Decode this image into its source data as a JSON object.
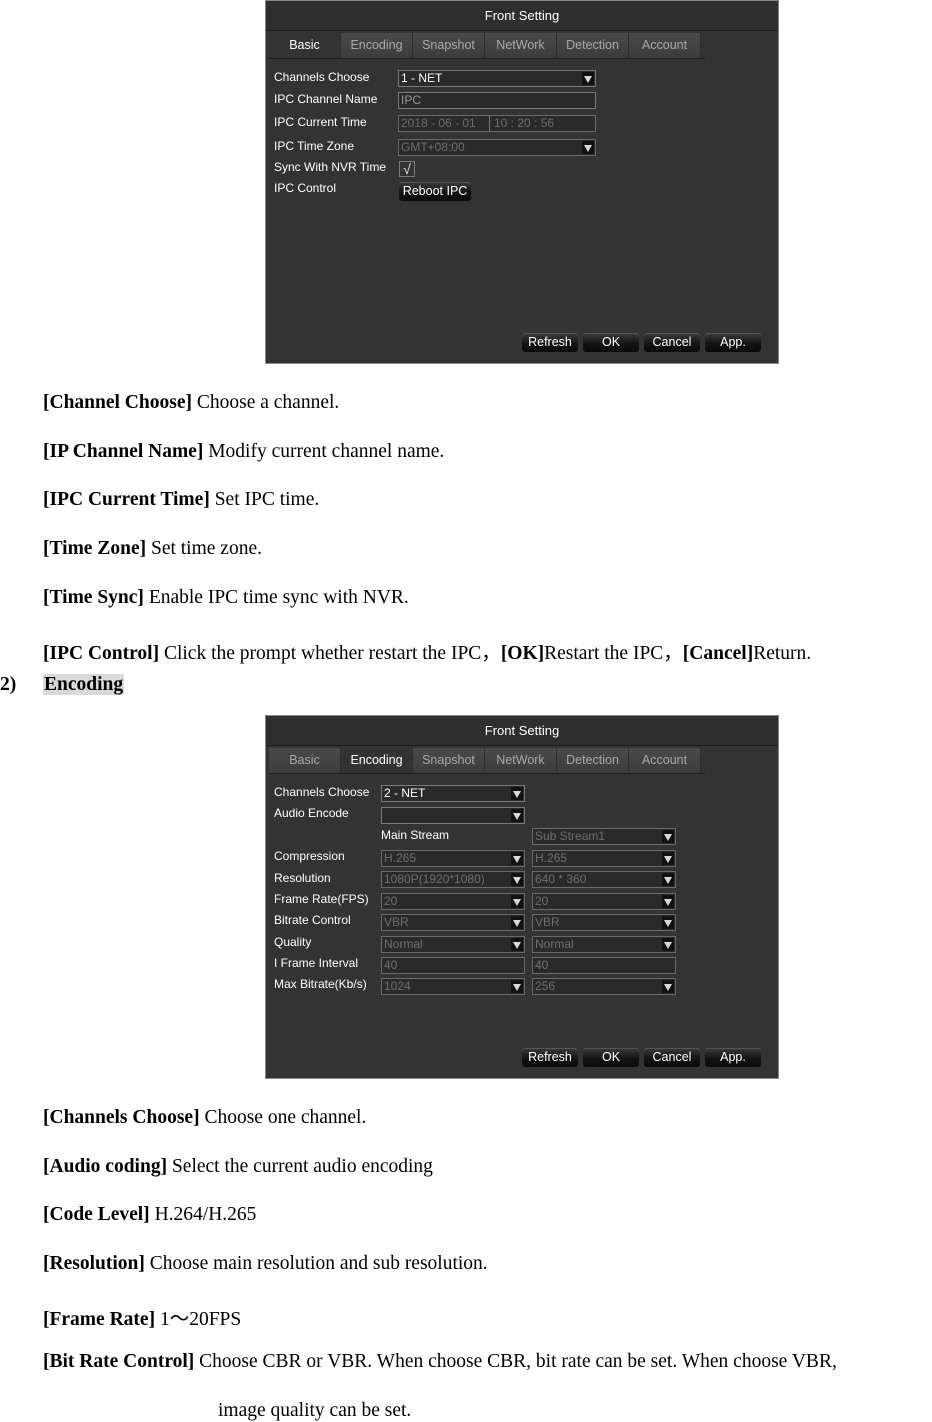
{
  "panel1": {
    "title": "Front Setting",
    "tabs": [
      "Basic",
      "Encoding",
      "Snapshot",
      "NetWork",
      "Detection",
      "Account"
    ],
    "active_tab": "Basic",
    "labels": {
      "channels_choose": "Channels Choose",
      "ipc_channel_name": "IPC Channel Name",
      "ipc_current_time": "IPC Current Time",
      "ipc_time_zone": "IPC Time Zone",
      "sync_with_nvr": "Sync With NVR Time",
      "ipc_control": "IPC Control"
    },
    "values": {
      "channel": "1 - NET",
      "channel_name": "IPC",
      "date": "2018  - 06 - 01",
      "time": "10 : 20 : 56",
      "time_zone": "GMT+08:00",
      "sync_checked": "√"
    },
    "reboot_button": "Reboot IPC",
    "buttons": {
      "refresh": "Refresh",
      "ok": "OK",
      "cancel": "Cancel",
      "apply": "App."
    }
  },
  "desc1": [
    {
      "bold": "[Channel Choose]",
      "text": " Choose a channel."
    },
    {
      "bold": "[IP Channel Name]",
      "text": " Modify current channel name."
    },
    {
      "bold": "[IPC Current Time]",
      "text": " Set IPC time."
    },
    {
      "bold": "[Time Zone]",
      "text": " Set time zone."
    },
    {
      "bold": "[Time Sync]",
      "text": " Enable IPC time sync with NVR."
    }
  ],
  "ipc_control_desc": {
    "b1": "[IPC Control]",
    "t1": " Click the prompt whether restart the IPC，",
    "b2": "[OK]",
    "t2": "Restart the IPC，",
    "b3": "[Cancel]",
    "t3": "Return."
  },
  "section": {
    "number": "2)",
    "title": "Encoding"
  },
  "panel2": {
    "title": "Front Setting",
    "tabs": [
      "Basic",
      "Encoding",
      "Snapshot",
      "NetWork",
      "Detection",
      "Account"
    ],
    "active_tab": "Encoding",
    "labels": {
      "channels_choose": "Channels Choose",
      "audio_encode": "Audio Encode",
      "main_stream": "Main Stream",
      "compression": "Compression",
      "resolution": "Resolution",
      "frame_rate": "Frame Rate(FPS)",
      "bitrate_control": "Bitrate Control",
      "quality": "Quality",
      "i_frame_interval": "I Frame Interval",
      "max_bitrate": "Max Bitrate(Kb/s)"
    },
    "channel": "2 - NET",
    "audio_encode": "",
    "sub_stream": "Sub Stream1",
    "main": {
      "compression": "H.265",
      "resolution": "1080P(1920*1080)",
      "frame_rate": "20",
      "bitrate_control": "VBR",
      "quality": "Normal",
      "i_frame_interval": "40",
      "max_bitrate": "1024"
    },
    "sub": {
      "compression": "H.265",
      "resolution": "640 * 360",
      "frame_rate": "20",
      "bitrate_control": "VBR",
      "quality": "Normal",
      "i_frame_interval": "40",
      "max_bitrate": "256"
    },
    "buttons": {
      "refresh": "Refresh",
      "ok": "OK",
      "cancel": "Cancel",
      "apply": "App."
    }
  },
  "desc2": [
    {
      "bold": "[Channels Choose]",
      "text": " Choose one channel."
    },
    {
      "bold": "[Audio coding]",
      "text": " Select the current audio encoding"
    },
    {
      "bold": "[Code Level]",
      "text": " H.264/H.265"
    },
    {
      "bold": "[Resolution]",
      "text": " Choose main resolution and sub resolution."
    },
    {
      "bold": "[Frame Rate]",
      "text": " 1～20FPS"
    },
    {
      "bold": "[Bit Rate Control]",
      "text": " Choose CBR or VBR. When choose CBR, bit rate can be set. When choose VBR,"
    }
  ],
  "desc2_cont": "image quality can be set."
}
